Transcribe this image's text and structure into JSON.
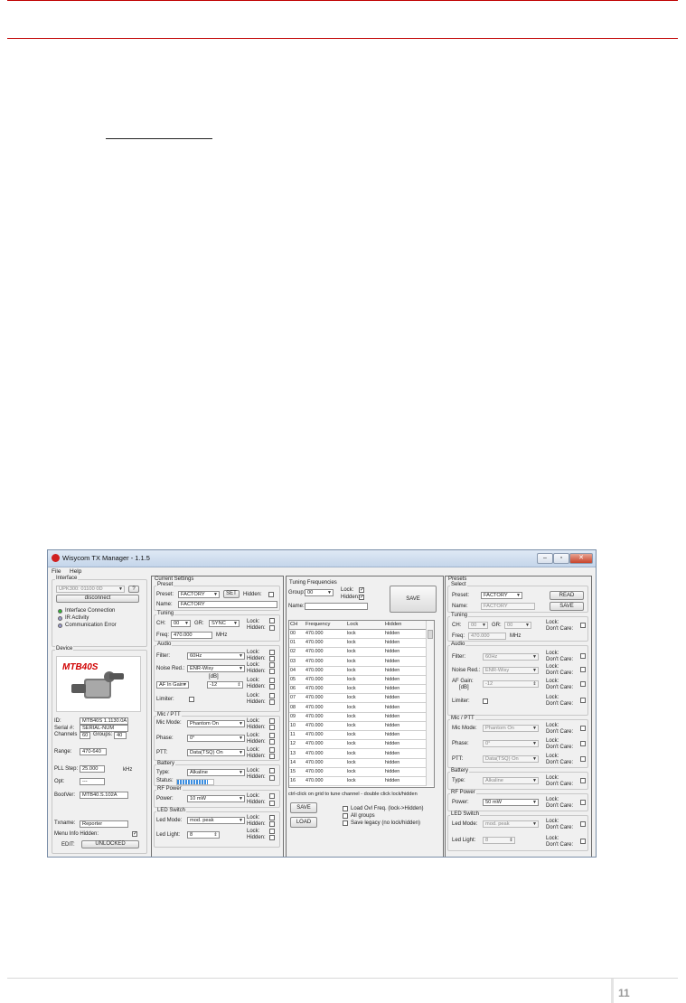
{
  "page": {
    "number": "11"
  },
  "window": {
    "title": "Wisycom TX Manager - 1.1.5",
    "controls": {
      "minimize": "–",
      "maximize": "▫",
      "close": "✕"
    },
    "menu": [
      "File",
      "Help"
    ]
  },
  "interface": {
    "title": "Interface",
    "port": "UPK300: 01100 0D",
    "help": "?",
    "disconnect": "disconnect",
    "indicators": [
      {
        "label": "Interface Connection",
        "color": "#2eb82e"
      },
      {
        "label": "IR Activity",
        "color": "#9a9acc"
      },
      {
        "label": "Communication Error",
        "color": "#9a9acc"
      }
    ]
  },
  "device": {
    "title": "Device",
    "model_badge": "MTB40S",
    "fields": [
      {
        "label": "ID:",
        "value": "MTB40S 1.1130.0A"
      },
      {
        "label": "Serial #:",
        "value": "SERIAL-NUM"
      },
      {
        "label": "Range:",
        "value": "470-640"
      },
      {
        "label": "PLL Step:",
        "value": "25.000"
      },
      {
        "label": "Opt:",
        "value": "---"
      },
      {
        "label": "BootVer:",
        "value": "MTB40.S.102A"
      }
    ],
    "channels_label": "Channels",
    "channels_value": "60",
    "groups_label": "Groups:",
    "groups_value": "40",
    "pll_unit": "kHz",
    "txname_label": "Txname:",
    "txname_value": "Reporter",
    "menu_info_hidden_label": "Menu Info Hidden:",
    "edit_label": "EDIT:",
    "edit_value": "UNLOCKED"
  },
  "current": {
    "title": "Current Settings",
    "preset_group": "Preset",
    "preset_label": "Preset:",
    "preset_value": "FACTORY",
    "set_button": "SET",
    "hidden_label": "Hidden:",
    "name_label": "Name:",
    "name_value": "FACTORY",
    "tuning_group": "Tuning",
    "ch_label": "CH:",
    "ch_value": "00",
    "gr_label": "GR:",
    "gr_value": "SYNC",
    "freq_label": "Freq:",
    "freq_value": "470.000",
    "freq_unit": "MHz",
    "lock": "Lock:",
    "hidden": "Hidden:",
    "audio_group": "Audio",
    "filter_label": "Filter:",
    "filter_value": "60Hz",
    "noise_label": "Noise Red.:",
    "noise_value": "ENR-Wisy",
    "db_label": "[dB]",
    "afin_value": "AF In Gain",
    "afin_num": "-12",
    "limiter_label": "Limiter:",
    "mic_group": "Mic / PTT",
    "micmode_label": "Mic Mode:",
    "micmode_value": "Phantom On",
    "phase_label": "Phase:",
    "phase_value": "0°",
    "ptt_label": "PTT:",
    "ptt_value": "Data(TSQ) On",
    "battery_group": "Battery",
    "type_label": "Type:",
    "type_value": "Alkaline",
    "status_label": "Status:",
    "battery_level": 0.85,
    "rf_group": "RF Power",
    "power_label": "Power:",
    "power_value": "10 mW",
    "led_group": "LED Switch",
    "ledmode_label": "Led Mode:",
    "ledmode_value": "mod. peak",
    "ledlight_label": "Led Light:",
    "ledlight_value": "8"
  },
  "tuning": {
    "title": "Tuning Frequencies",
    "group_label": "Group:",
    "group_value": "00",
    "lock_label": "Lock:",
    "hidden_label": "Hidden:",
    "name_label": "Name:",
    "save_top": "SAVE",
    "headers": [
      "CH",
      "Frequency",
      "Lock",
      "Hidden"
    ],
    "rows": [
      [
        "00",
        "470.000",
        "lock",
        "hidden"
      ],
      [
        "01",
        "470.000",
        "lock",
        "hidden"
      ],
      [
        "02",
        "470.000",
        "lock",
        "hidden"
      ],
      [
        "03",
        "470.000",
        "lock",
        "hidden"
      ],
      [
        "04",
        "470.000",
        "lock",
        "hidden"
      ],
      [
        "05",
        "470.000",
        "lock",
        "hidden"
      ],
      [
        "06",
        "470.000",
        "lock",
        "hidden"
      ],
      [
        "07",
        "470.000",
        "lock",
        "hidden"
      ],
      [
        "08",
        "470.000",
        "lock",
        "hidden"
      ],
      [
        "09",
        "470.000",
        "lock",
        "hidden"
      ],
      [
        "10",
        "470.000",
        "lock",
        "hidden"
      ],
      [
        "11",
        "470.000",
        "lock",
        "hidden"
      ],
      [
        "12",
        "470.000",
        "lock",
        "hidden"
      ],
      [
        "13",
        "470.000",
        "lock",
        "hidden"
      ],
      [
        "14",
        "470.000",
        "lock",
        "hidden"
      ],
      [
        "15",
        "470.000",
        "lock",
        "hidden"
      ],
      [
        "16",
        "470.000",
        "lock",
        "hidden"
      ]
    ],
    "hint": "ctrl-click on grid to tune channel - double click lock/hidden",
    "save": "SAVE",
    "load": "LOAD",
    "options": [
      "Load Ovl Freq. (lock->Hidden)",
      "All groups",
      "Save legacy (no lock/hidden)"
    ]
  },
  "presets": {
    "title": "Presets",
    "select_group": "Select",
    "preset_label": "Preset:",
    "preset_value": "FACTORY",
    "read": "READ",
    "name_label": "Name:",
    "name_value": "FACTORY",
    "save": "SAVE",
    "tuning_group": "Tuning",
    "ch_label": "CH:",
    "ch_value": "00",
    "gr_label": "GR:",
    "gr_value": "00",
    "freq_label": "Freq:",
    "freq_value": "470.000",
    "freq_unit": "MHz",
    "lock": "Lock:",
    "dontcare": "Don't Care:",
    "audio_group": "Audio",
    "filter_label": "Filter:",
    "filter_value": "60Hz",
    "noise_label": "Noise Red.:",
    "noise_value": "ENR-Wisy",
    "afgain_label": "AF Gain:",
    "afgain_unit": "[dB]",
    "afgain_value": "-12",
    "limiter_label": "Limiter:",
    "mic_group": "Mic / PTT",
    "micmode_label": "Mic Mode:",
    "micmode_value": "Phantom On",
    "phase_label": "Phase:",
    "phase_value": "0°",
    "ptt_label": "PTT:",
    "ptt_value": "Data(TSQ) On",
    "battery_group": "Battery",
    "type_label": "Type:",
    "type_value": "Alkaline",
    "rf_group": "RF Power",
    "power_label": "Power:",
    "power_value": "50 mW",
    "led_group": "LED Switch",
    "ledmode_label": "Led Mode:",
    "ledmode_value": "mod. peak",
    "ledlight_label": "Led Light:",
    "ledlight_value": "8"
  }
}
